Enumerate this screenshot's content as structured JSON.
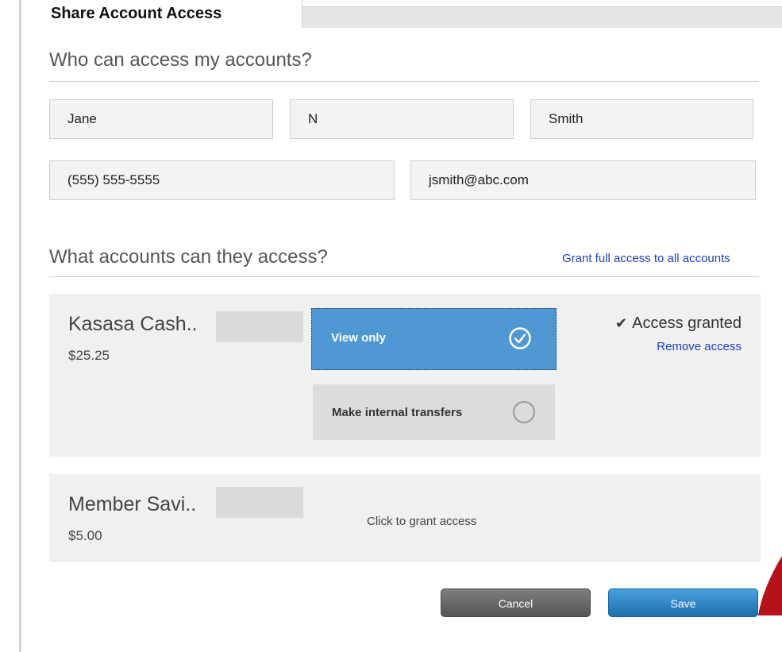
{
  "tabs": {
    "active_label": "Share Account Access"
  },
  "who_section": {
    "title": "Who can access my accounts?",
    "first_name": "Jane",
    "middle_initial": "N",
    "last_name": "Smith",
    "phone": "(555) 555-5555",
    "email": "jsmith@abc.com"
  },
  "accounts_section": {
    "title": "What accounts can they access?",
    "grant_all_link": "Grant full access to all accounts",
    "accounts": [
      {
        "name": "Kasasa Cash..",
        "balance": "$25.25",
        "options": [
          {
            "label": "View only",
            "selected": true
          },
          {
            "label": "Make internal transfers",
            "selected": false
          }
        ],
        "status": "Access granted",
        "remove_link": "Remove access"
      },
      {
        "name": "Member Savi..",
        "balance": "$5.00",
        "grant_link": "Click to grant access"
      }
    ]
  },
  "buttons": {
    "cancel": "Cancel",
    "save": "Save"
  },
  "colors": {
    "selected_option": "#4f98d3",
    "link": "#1f3fbf",
    "save_button": "#1d6fae",
    "cancel_button": "#555555",
    "corner_accent": "#b5121b"
  }
}
